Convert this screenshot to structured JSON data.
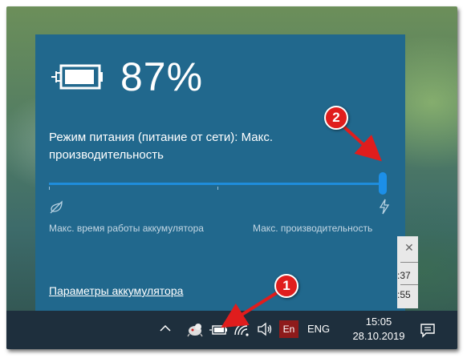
{
  "battery": {
    "percent": "87%",
    "charging": true
  },
  "power_mode": {
    "label": "Режим питания (питание от сети): Макс. производительность",
    "level": 1.0,
    "left_label": "Макс. время работы аккумулятора",
    "right_label": "Макс. производительность"
  },
  "settings_link": "Параметры аккумулятора",
  "notification_peek": {
    "time1": ":37",
    "time2": ":55"
  },
  "taskbar": {
    "input_badge": "En",
    "language": "ENG",
    "time": "15:05",
    "date": "28.10.2019",
    "icons": [
      "chevron-up-icon",
      "app-tray-icon",
      "battery-icon",
      "wifi-icon",
      "volume-icon",
      "action-center-icon"
    ]
  },
  "annotations": [
    {
      "number": "1"
    },
    {
      "number": "2"
    }
  ],
  "colors": {
    "flyout": "#21688d",
    "slider": "#1c8fe8",
    "taskbar": "#1e2f3d",
    "annotation": "#e01d1d"
  }
}
